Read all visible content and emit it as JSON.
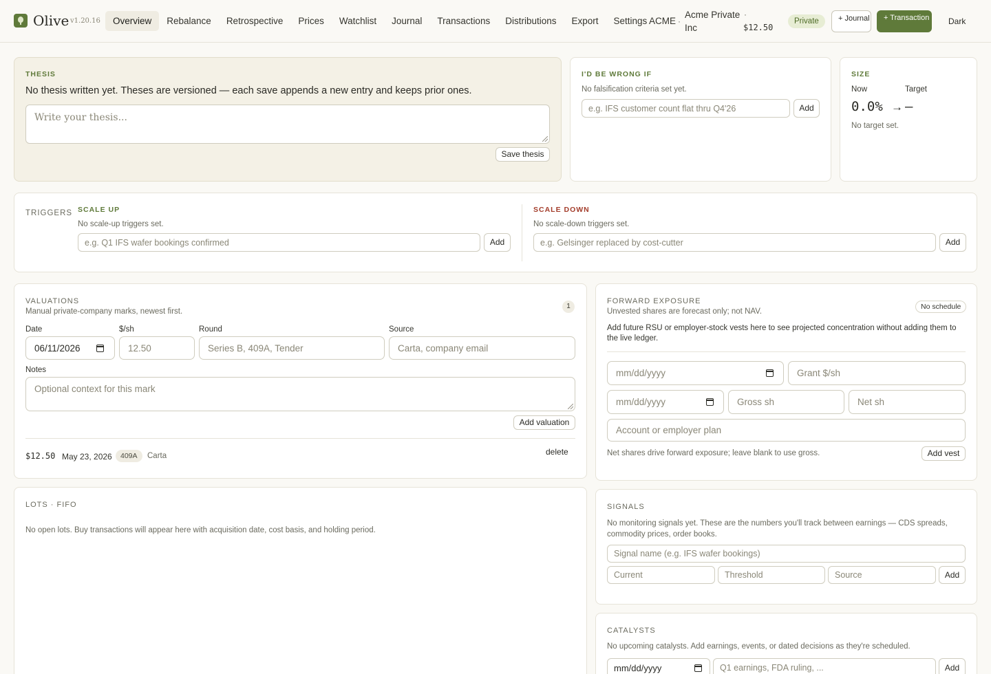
{
  "app": {
    "name": "Olive",
    "version": "v1.20.16"
  },
  "nav": [
    {
      "label": "Overview",
      "active": true
    },
    {
      "label": "Rebalance"
    },
    {
      "label": "Retrospective"
    },
    {
      "label": "Prices"
    },
    {
      "label": "Watchlist"
    },
    {
      "label": "Journal"
    },
    {
      "label": "Transactions"
    },
    {
      "label": "Distributions"
    },
    {
      "label": "Export"
    },
    {
      "label": "Settings"
    }
  ],
  "security": {
    "ticker": "ACME",
    "separator": "·",
    "name": "Acme Private Inc",
    "price": "$12.50",
    "status": "Private"
  },
  "header_actions": {
    "journal": "+ Journal",
    "transaction": "+ Transaction",
    "theme": "Dark"
  },
  "thesis": {
    "label": "THESIS",
    "text": "No thesis written yet. Theses are versioned — each save appends a new entry and keeps prior ones.",
    "placeholder": "Write your thesis...",
    "save": "Save thesis"
  },
  "wrong_if": {
    "label": "I'D BE WRONG IF",
    "empty": "No falsification criteria set yet.",
    "placeholder": "e.g. IFS customer count flat thru Q4'26",
    "add": "Add"
  },
  "size": {
    "label": "SIZE",
    "now_label": "Now",
    "target_label": "Target",
    "now_value": "0.0%",
    "arrow": "→",
    "target_value": "—",
    "note": "No target set."
  },
  "triggers": {
    "label": "TRIGGERS",
    "up": {
      "label": "SCALE UP",
      "empty": "No scale-up triggers set.",
      "placeholder": "e.g. Q1 IFS wafer bookings confirmed",
      "add": "Add"
    },
    "down": {
      "label": "SCALE DOWN",
      "empty": "No scale-down triggers set.",
      "placeholder": "e.g. Gelsinger replaced by cost-cutter",
      "add": "Add"
    }
  },
  "valuations": {
    "label": "VALUATIONS",
    "subtitle": "Manual private-company marks, newest first.",
    "count": "1",
    "date_label": "Date",
    "date_value": "06/11/2026",
    "price_label": "$/sh",
    "price_value": "12.50",
    "round_label": "Round",
    "round_placeholder": "Series B, 409A, Tender",
    "source_label": "Source",
    "source_placeholder": "Carta, company email",
    "notes_label": "Notes",
    "notes_placeholder": "Optional context for this mark",
    "add": "Add valuation",
    "entries": [
      {
        "price": "$12.50",
        "date": "May 23, 2026",
        "round": "409A",
        "source": "Carta",
        "action": "delete"
      }
    ]
  },
  "forward": {
    "label": "FORWARD EXPOSURE",
    "subtitle": "Unvested shares are forecast only; not NAV.",
    "badge": "No schedule",
    "description": "Add future RSU or employer-stock vests here to see projected concentration without adding them to the live ledger.",
    "date1_placeholder": "mm/dd/yyyy",
    "grant_placeholder": "Grant $/sh",
    "date2_placeholder": "mm/dd/yyyy",
    "gross_placeholder": "Gross sh",
    "net_placeholder": "Net sh",
    "account_placeholder": "Account or employer plan",
    "note": "Net shares drive forward exposure; leave blank to use gross.",
    "add": "Add vest"
  },
  "lots": {
    "label": "LOTS · FIFO",
    "empty": "No open lots. Buy transactions will appear here with acquisition date, cost basis, and holding period."
  },
  "signals": {
    "label": "SIGNALS",
    "empty": "No monitoring signals yet. These are the numbers you'll track between earnings — CDS spreads, commodity prices, order books.",
    "name_placeholder": "Signal name (e.g. IFS wafer bookings)",
    "current_placeholder": "Current",
    "threshold_placeholder": "Threshold",
    "source_placeholder": "Source",
    "add": "Add"
  },
  "catalysts": {
    "label": "CATALYSTS",
    "empty": "No upcoming catalysts. Add earnings, events, or dated decisions as they're scheduled.",
    "date_placeholder": "mm/dd/yyyy",
    "event_placeholder": "Q1 earnings, FDA ruling, ...",
    "add": "Add"
  }
}
